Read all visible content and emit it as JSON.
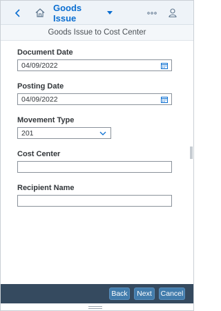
{
  "header": {
    "title": "Goods Issue",
    "back_icon": "back-icon",
    "home_icon": "home-icon",
    "more_icon": "overflow-icon",
    "user_icon": "user-icon"
  },
  "subheader": {
    "title": "Goods Issue to Cost Center"
  },
  "form": {
    "document_date": {
      "label": "Document Date",
      "value": "04/09/2022",
      "icon": "calendar-icon"
    },
    "posting_date": {
      "label": "Posting Date",
      "value": "04/09/2022",
      "icon": "calendar-icon"
    },
    "movement_type": {
      "label": "Movement Type",
      "value": "201",
      "icon": "chevron-down-icon"
    },
    "cost_center": {
      "label": "Cost Center",
      "value": ""
    },
    "recipient_name": {
      "label": "Recipient Name",
      "value": ""
    }
  },
  "footer": {
    "back_label": "Back",
    "next_label": "Next",
    "cancel_label": "Cancel"
  },
  "colors": {
    "brand": "#0a6ed1",
    "footer_bg": "#354a5f",
    "button_bg": "#427cac"
  }
}
